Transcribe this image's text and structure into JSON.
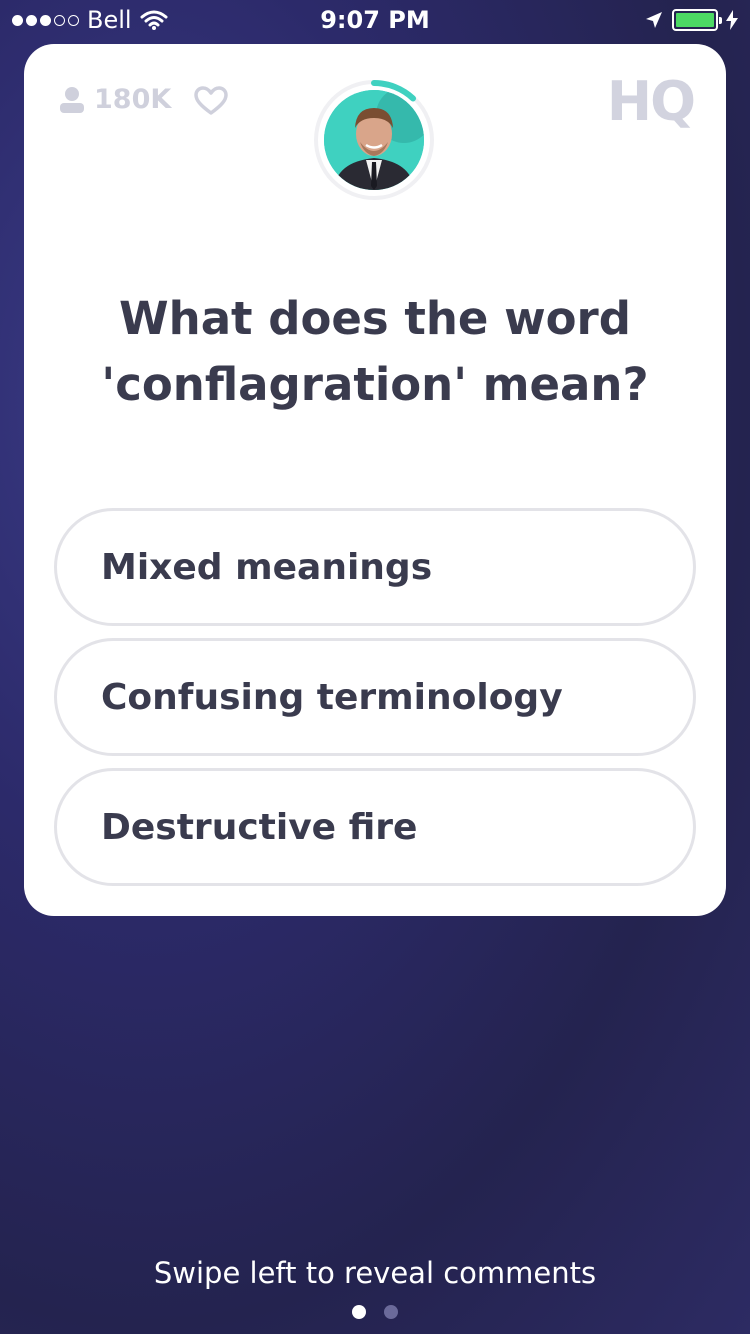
{
  "status_bar": {
    "carrier": "Bell",
    "time": "9:07 PM",
    "signal_filled": 3,
    "signal_total": 5,
    "battery_level": 1.0,
    "battery_color": "#4cd964"
  },
  "header": {
    "viewers": "180K",
    "logo": "HQ",
    "icons": [
      "person-icon",
      "heart-icon"
    ]
  },
  "host": {
    "timer_progress": 0.12,
    "ring_color": "#3fd1c0"
  },
  "question": {
    "text": "What does the word 'conflagration' mean?"
  },
  "answers": [
    {
      "label": "Mixed meanings"
    },
    {
      "label": "Confusing terminology"
    },
    {
      "label": "Destructive fire"
    }
  ],
  "footer": {
    "hint": "Swipe left to reveal comments",
    "page_count": 2,
    "active_page": 1
  }
}
